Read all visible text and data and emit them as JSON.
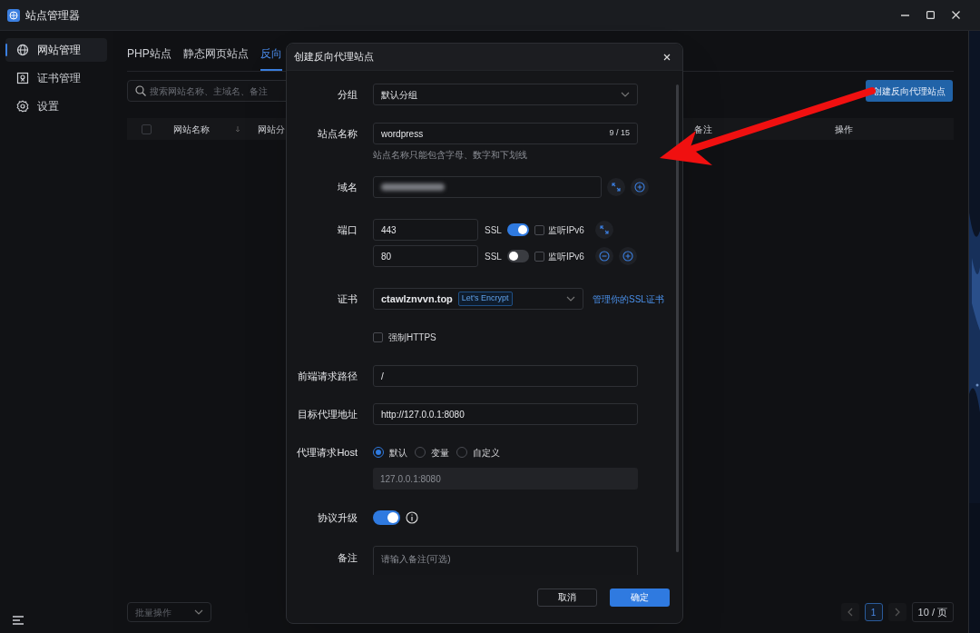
{
  "window": {
    "title": "站点管理器"
  },
  "sidebar": {
    "items": [
      {
        "label": "网站管理",
        "kind": "globe",
        "selected": true
      },
      {
        "label": "证书管理",
        "kind": "certificate",
        "selected": false
      },
      {
        "label": "设置",
        "kind": "gear",
        "selected": false
      }
    ]
  },
  "tabs": [
    {
      "label": "PHP站点",
      "selected": false
    },
    {
      "label": "静态网页站点",
      "selected": false
    },
    {
      "label": "反向",
      "selected": true
    }
  ],
  "search": {
    "placeholder": "搜索网站名称、主域名、备注"
  },
  "create_button": "创建反向代理站点",
  "table": {
    "columns": [
      "网站名称",
      "网站分",
      "备注",
      "操作"
    ],
    "select_all_checked": false
  },
  "batch": {
    "placeholder": "批量操作"
  },
  "pagination": {
    "pages": [
      {
        "label": "1",
        "selected": true
      }
    ],
    "page_size": "10 / 页"
  },
  "dialog": {
    "title": "创建反向代理站点",
    "group": {
      "label": "分组",
      "value": "默认分组"
    },
    "site_name": {
      "label": "站点名称",
      "value": "wordpress",
      "count": "9 / 15",
      "hint": "站点名称只能包含字母、数字和下划线"
    },
    "domain": {
      "label": "域名"
    },
    "port_label": "端口",
    "ports": [
      {
        "value": "443",
        "ssl_label": "SSL",
        "ssl": true,
        "ipv6_label": "监听IPv6",
        "ipv6": false
      },
      {
        "value": "80",
        "ssl_label": "SSL",
        "ssl": false,
        "ipv6_label": "监听IPv6",
        "ipv6": false
      }
    ],
    "cert": {
      "label": "证书",
      "value": "ctawlznvvn.top",
      "tag": "Let's Encrypt",
      "link": "管理你的SSL证书"
    },
    "force_https": {
      "label": "强制HTTPS",
      "checked": false
    },
    "path": {
      "label": "前端请求路径",
      "value": "/"
    },
    "target": {
      "label": "目标代理地址",
      "value": "http://127.0.0.1:8080"
    },
    "host": {
      "label": "代理请求Host",
      "options": [
        {
          "label": "默认",
          "selected": true
        },
        {
          "label": "变量",
          "selected": false
        },
        {
          "label": "自定义",
          "selected": false
        }
      ],
      "value": "127.0.0.1:8080"
    },
    "upgrade": {
      "label": "协议升级",
      "on": true
    },
    "note": {
      "label": "备注",
      "placeholder": "请输入备注(可选)"
    },
    "buttons": {
      "cancel": "取消",
      "ok": "确定"
    }
  }
}
